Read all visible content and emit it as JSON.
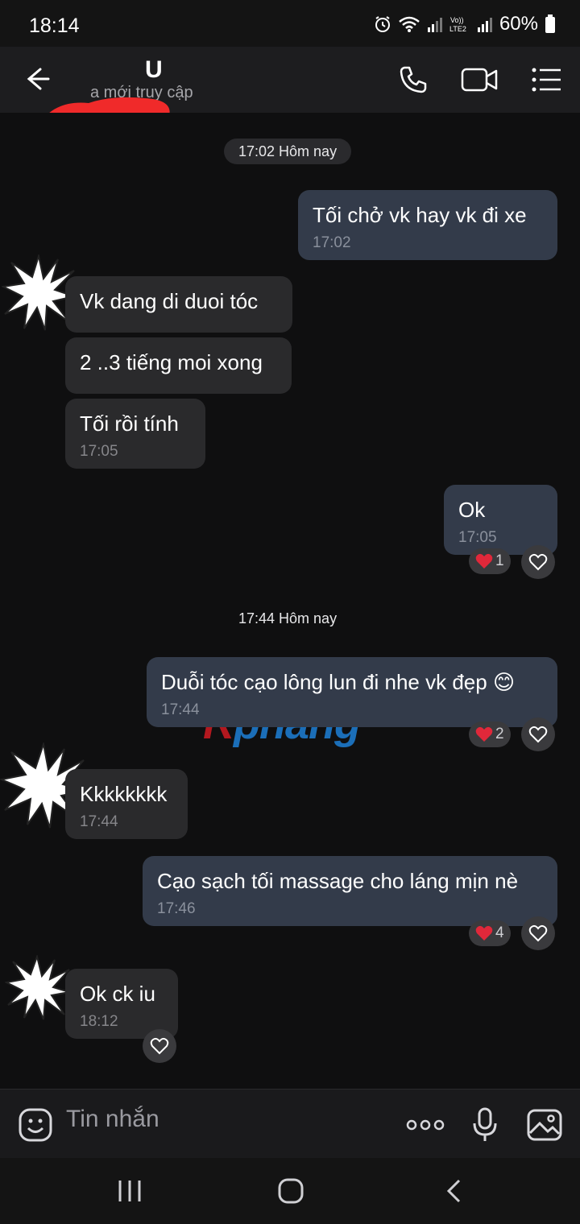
{
  "status_bar": {
    "time": "18:14",
    "battery": "60%"
  },
  "header": {
    "contact_name": "U",
    "contact_status": "a mới truy cập"
  },
  "messages": [
    {
      "type": "date",
      "text": "17:02 Hôm nay"
    },
    {
      "type": "out",
      "text": "Tối chở vk hay vk đi xe",
      "time": "17:02"
    },
    {
      "type": "in",
      "text": "Vk dang di duoi tóc"
    },
    {
      "type": "in",
      "text": "2 ..3 tiếng moi xong"
    },
    {
      "type": "in",
      "text": "Tối rồi tính",
      "time": "17:05"
    },
    {
      "type": "out",
      "text": "Ok",
      "time": "17:05",
      "reaction_count": "1"
    },
    {
      "type": "date",
      "text": "17:44 Hôm nay"
    },
    {
      "type": "out",
      "text": "Duỗi tóc cạo lông lun đi nhe vk đẹp 😊",
      "time": "17:44",
      "reaction_count": "2"
    },
    {
      "type": "in",
      "text": "Kkkkkkkk",
      "time": "17:44"
    },
    {
      "type": "out",
      "text": "Cạo sạch tối massage cho láng mịn nè",
      "time": "17:46",
      "reaction_count": "4"
    },
    {
      "type": "in",
      "text": "Ok ck iu",
      "time": "18:12"
    }
  ],
  "watermark": {
    "part1": "R",
    "part2": "phang"
  },
  "composer": {
    "placeholder": "Tin nhắn"
  },
  "colors": {
    "bubble_out": "#333b4a",
    "bubble_in": "#2a2a2c",
    "heart": "#e0283a"
  }
}
